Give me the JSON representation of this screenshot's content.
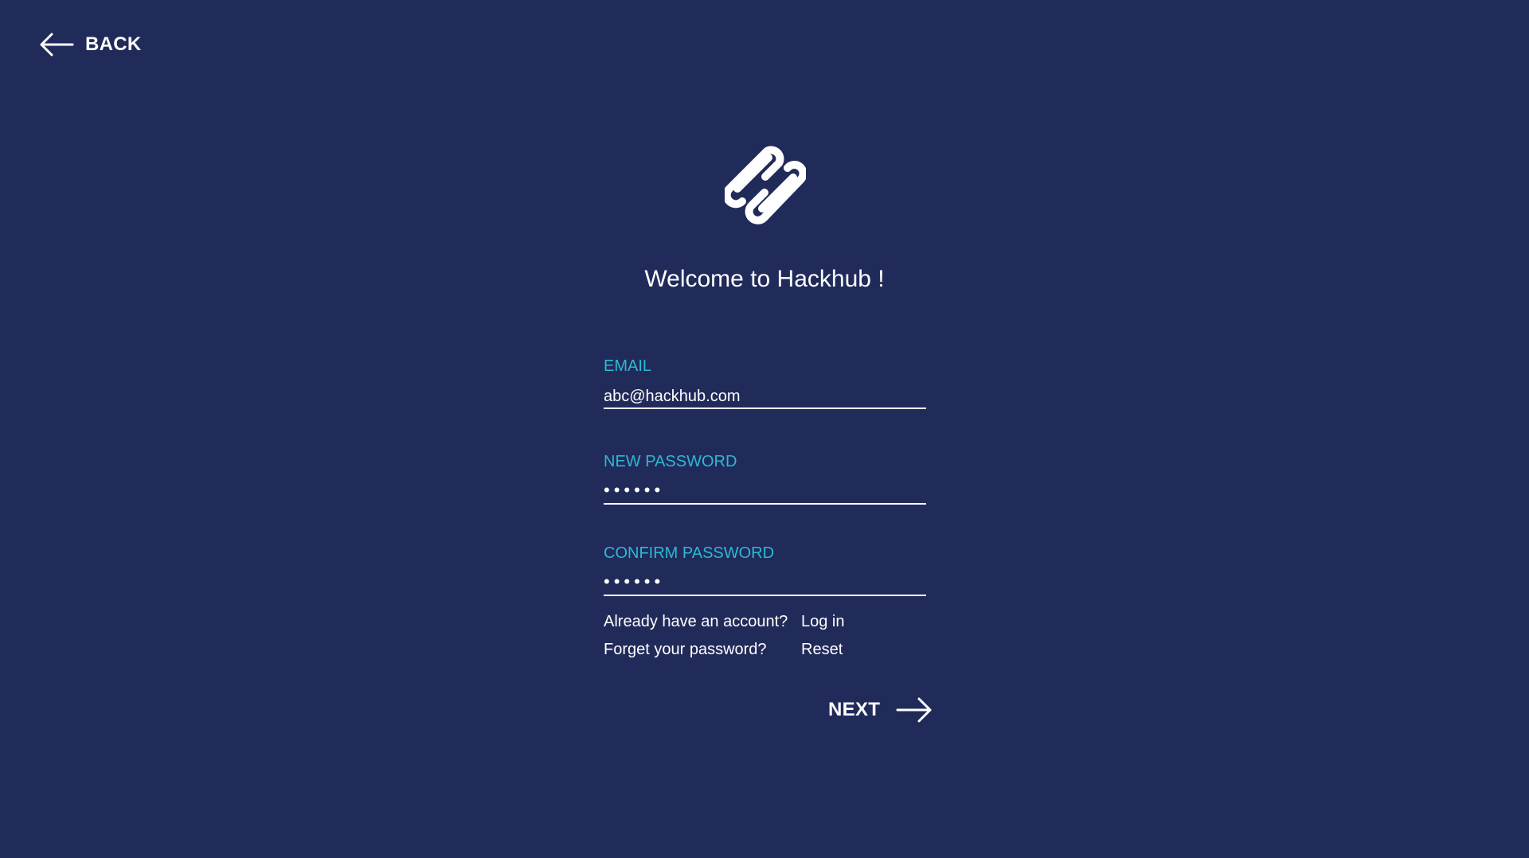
{
  "header": {
    "back_label": "BACK"
  },
  "welcome_title": "Welcome to Hackhub !",
  "form": {
    "email": {
      "label": "EMAIL",
      "value": "abc@hackhub.com"
    },
    "new_password": {
      "label": "NEW PASSWORD",
      "value": "••••••"
    },
    "confirm_password": {
      "label": "CONFIRM PASSWORD",
      "value": "••••••"
    }
  },
  "links": {
    "login_question": "Already have an account?",
    "login_link": "Log in",
    "reset_question": "Forget your password?",
    "reset_link": "Reset"
  },
  "next_label": "NEXT",
  "icons": {
    "back": "arrow-left-icon",
    "next": "arrow-right-icon",
    "logo": "hackhub-logo"
  },
  "colors": {
    "background": "#212b5a",
    "text": "#ffffff",
    "accent": "#2cb9d3"
  }
}
